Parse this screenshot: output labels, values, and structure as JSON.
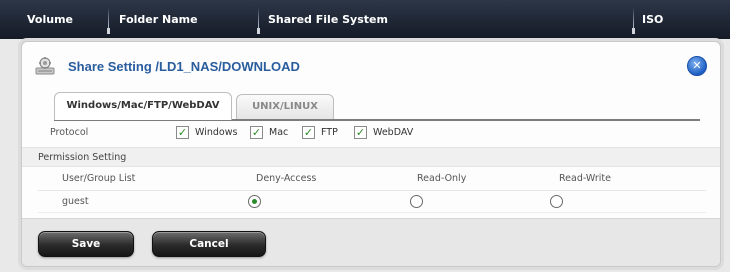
{
  "table_header": {
    "columns": [
      "Volume",
      "Folder Name",
      "Shared File System",
      "ISO"
    ]
  },
  "dialog": {
    "title": "Share Setting /LD1_NAS/DOWNLOAD",
    "close_icon": "close-icon",
    "accent_color": "#2a5d9e"
  },
  "tabs": [
    {
      "label": "Windows/Mac/FTP/WebDAV",
      "active": true
    },
    {
      "label": "UNIX/LINUX",
      "active": false
    }
  ],
  "protocol": {
    "label": "Protocol",
    "options": [
      {
        "label": "Windows",
        "checked": true
      },
      {
        "label": "Mac",
        "checked": true
      },
      {
        "label": "FTP",
        "checked": true
      },
      {
        "label": "WebDAV",
        "checked": true
      }
    ]
  },
  "permission": {
    "section_label": "Permission Setting",
    "headers": [
      "User/Group List",
      "Deny-Access",
      "Read-Only",
      "Read-Write"
    ],
    "rows": [
      {
        "name": "guest",
        "selected": "Deny-Access"
      }
    ]
  },
  "buttons": {
    "save": "Save",
    "cancel": "Cancel"
  }
}
